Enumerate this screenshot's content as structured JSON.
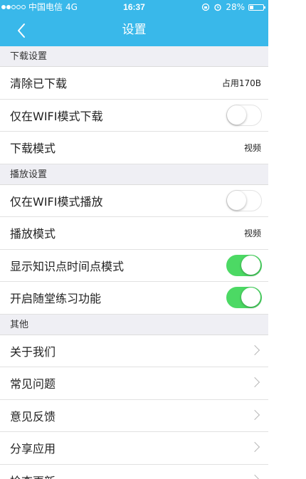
{
  "status_bar": {
    "carrier": "中国电信",
    "network": "4G",
    "time": "16:37",
    "battery": "28%",
    "battery_level": 0.28
  },
  "nav": {
    "title": "设置"
  },
  "sections": {
    "download": {
      "title": "下载设置",
      "clear": {
        "label": "清除已下载",
        "value": "占用170B"
      },
      "wifi_only": {
        "label": "仅在WIFI模式下载",
        "on": false
      },
      "mode": {
        "label": "下载模式",
        "value": "视频"
      }
    },
    "playback": {
      "title": "播放设置",
      "wifi_only": {
        "label": "仅在WIFI模式播放",
        "on": false
      },
      "mode": {
        "label": "播放模式",
        "value": "视频"
      },
      "knowledge_time": {
        "label": "显示知识点时间点模式",
        "on": true
      },
      "practice": {
        "label": "开启随堂练习功能",
        "on": true
      }
    },
    "other": {
      "title": "其他",
      "items": [
        {
          "label": "关于我们"
        },
        {
          "label": "常见问题"
        },
        {
          "label": "意见反馈"
        },
        {
          "label": "分享应用"
        },
        {
          "label": "检查更新"
        }
      ]
    }
  },
  "colors": {
    "header": "#39b8ea",
    "switch_on": "#4cd964",
    "section_bg": "#efeff4"
  }
}
